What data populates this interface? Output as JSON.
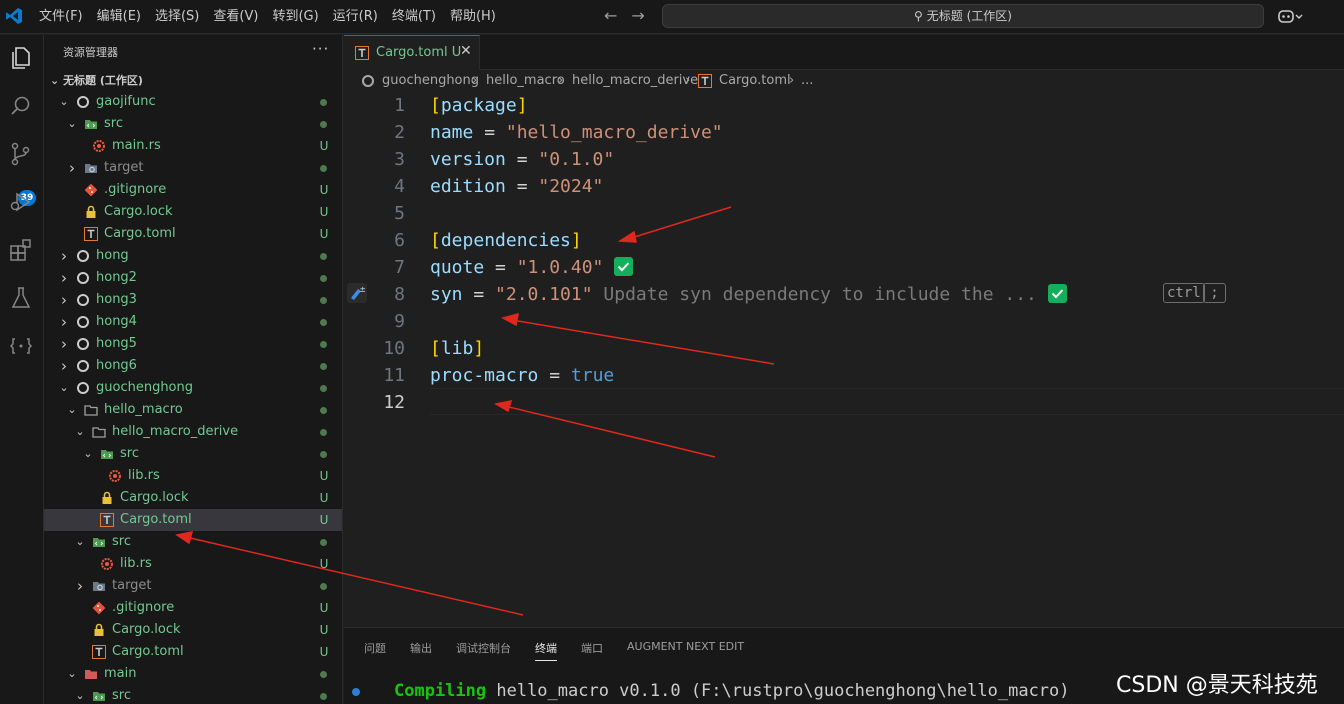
{
  "menu": [
    "文件(F)",
    "编辑(E)",
    "选择(S)",
    "查看(V)",
    "转到(G)",
    "运行(R)",
    "终端(T)",
    "帮助(H)"
  ],
  "command_center": "无标题 (工作区)",
  "activity": {
    "scm_badge": "39"
  },
  "sidebar": {
    "title": "资源管理器",
    "workspace": "无标题 (工作区)",
    "items": [
      {
        "label": "gaojifunc",
        "status": ""
      },
      {
        "label": "src",
        "status": ""
      },
      {
        "label": "main.rs",
        "status": "U"
      },
      {
        "label": "target",
        "status": ""
      },
      {
        "label": ".gitignore",
        "status": "U"
      },
      {
        "label": "Cargo.lock",
        "status": "U"
      },
      {
        "label": "Cargo.toml",
        "status": "U"
      },
      {
        "label": "hong",
        "status": ""
      },
      {
        "label": "hong2",
        "status": ""
      },
      {
        "label": "hong3",
        "status": ""
      },
      {
        "label": "hong4",
        "status": ""
      },
      {
        "label": "hong5",
        "status": ""
      },
      {
        "label": "hong6",
        "status": ""
      },
      {
        "label": "guochenghong",
        "status": ""
      },
      {
        "label": "hello_macro",
        "status": ""
      },
      {
        "label": "hello_macro_derive",
        "status": ""
      },
      {
        "label": "src",
        "status": ""
      },
      {
        "label": "lib.rs",
        "status": "U"
      },
      {
        "label": "Cargo.lock",
        "status": "U"
      },
      {
        "label": "Cargo.toml",
        "status": "U"
      },
      {
        "label": "src",
        "status": ""
      },
      {
        "label": "lib.rs",
        "status": "U"
      },
      {
        "label": "target",
        "status": ""
      },
      {
        "label": ".gitignore",
        "status": "U"
      },
      {
        "label": "Cargo.lock",
        "status": "U"
      },
      {
        "label": "Cargo.toml",
        "status": "U"
      },
      {
        "label": "main",
        "status": ""
      },
      {
        "label": "src",
        "status": ""
      }
    ]
  },
  "editor": {
    "tab_label": "Cargo.toml",
    "tab_status": "U",
    "breadcrumb": [
      "guochenghong",
      "hello_macro",
      "hello_macro_derive",
      "Cargo.toml",
      "..."
    ],
    "line_numbers": [
      "1",
      "2",
      "3",
      "4",
      "5",
      "6",
      "7",
      "8",
      "9",
      "10",
      "11",
      "12"
    ],
    "lines": {
      "l1": "package",
      "l2_key": "name",
      "l2_val": "\"hello_macro_derive\"",
      "l3_key": "version",
      "l3_val": "\"0.1.0\"",
      "l4_key": "edition",
      "l4_val": "\"2024\"",
      "l6": "dependencies",
      "l7_key": "quote",
      "l7_val": "\"1.0.40\"",
      "l8_key": "syn",
      "l8_val": "\"2.0.101\"",
      "l8_ghost": "Update syn dependency to include the ...",
      "l10": "lib",
      "l11_key": "proc-macro",
      "l11_val": "true"
    },
    "kbd_ctrl": "ctrl",
    "kbd_semicolon": ";"
  },
  "panel": {
    "tabs": [
      "问题",
      "输出",
      "调试控制台",
      "终端",
      "端口",
      "AUGMENT NEXT EDIT"
    ],
    "terminal_keyword": "Compiling",
    "terminal_rest": " hello_macro v0.1.0 (F:\\rustpro\\guochenghong\\hello_macro)"
  },
  "watermark": "CSDN @景天科技苑",
  "colors": {
    "accent": "#0078d4",
    "untracked": "#73c991",
    "annotation_arrow": "#e0281e"
  }
}
